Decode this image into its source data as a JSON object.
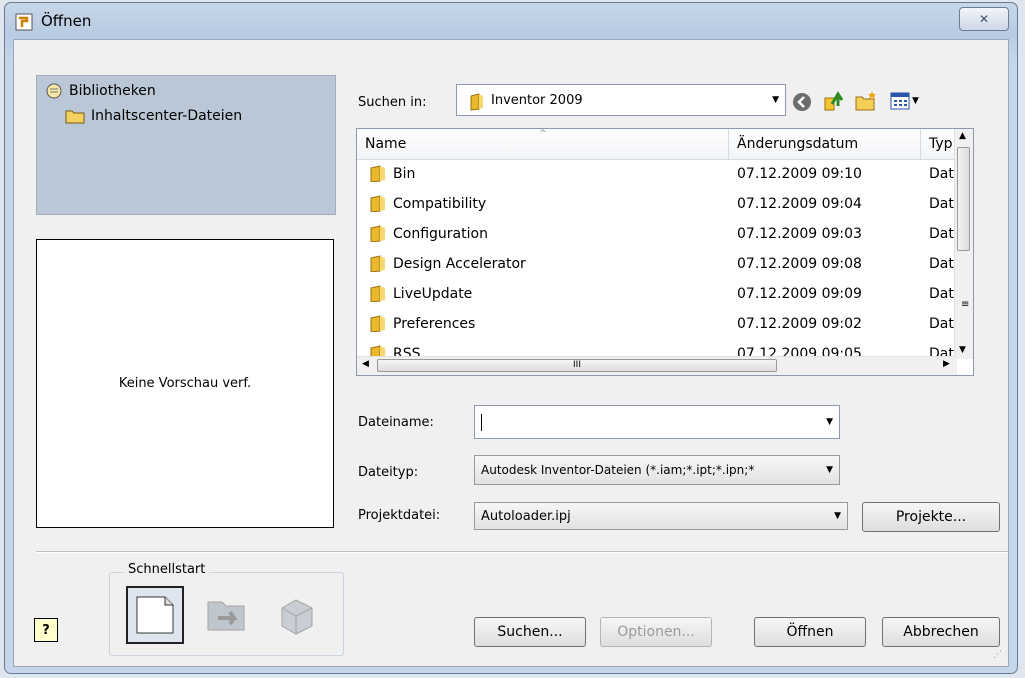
{
  "window": {
    "title": "Öffnen",
    "close_glyph": "✕"
  },
  "libraries": {
    "root": "Bibliotheken",
    "child": "Inhaltscenter-Dateien"
  },
  "preview": {
    "text": "Keine Vorschau verf."
  },
  "look_in": {
    "label": "Suchen in:",
    "value": "Inventor 2009"
  },
  "toolbar_icons": [
    "back-icon",
    "up-folder-icon",
    "new-folder-icon",
    "view-menu-icon"
  ],
  "file_list": {
    "columns": [
      "Name",
      "Änderungsdatum",
      "Typ"
    ],
    "rows": [
      {
        "name": "Bin",
        "date": "07.12.2009 09:10",
        "type": "Datei"
      },
      {
        "name": "Compatibility",
        "date": "07.12.2009 09:04",
        "type": "Datei"
      },
      {
        "name": "Configuration",
        "date": "07.12.2009 09:03",
        "type": "Datei"
      },
      {
        "name": "Design Accelerator",
        "date": "07.12.2009 09:08",
        "type": "Datei"
      },
      {
        "name": "LiveUpdate",
        "date": "07.12.2009 09:09",
        "type": "Datei"
      },
      {
        "name": "Preferences",
        "date": "07.12.2009 09:02",
        "type": "Datei"
      },
      {
        "name": "RSS",
        "date": "07.12.2009 09:05",
        "type": "Datei"
      }
    ],
    "hscroll_label": "III"
  },
  "filename": {
    "label": "Dateiname:",
    "value": ""
  },
  "filetype": {
    "label": "Dateityp:",
    "value": "Autodesk Inventor-Dateien (*.iam;*.ipt;*.ipn;*"
  },
  "project": {
    "label": "Projektdatei:",
    "value": "Autoloader.ipj",
    "button": "Projekte..."
  },
  "quickstart": {
    "title": "Schnellstart"
  },
  "help": {
    "glyph": "?"
  },
  "buttons": {
    "search": "Suchen...",
    "options": "Optionen...",
    "open": "Öffnen",
    "cancel": "Abbrechen"
  }
}
